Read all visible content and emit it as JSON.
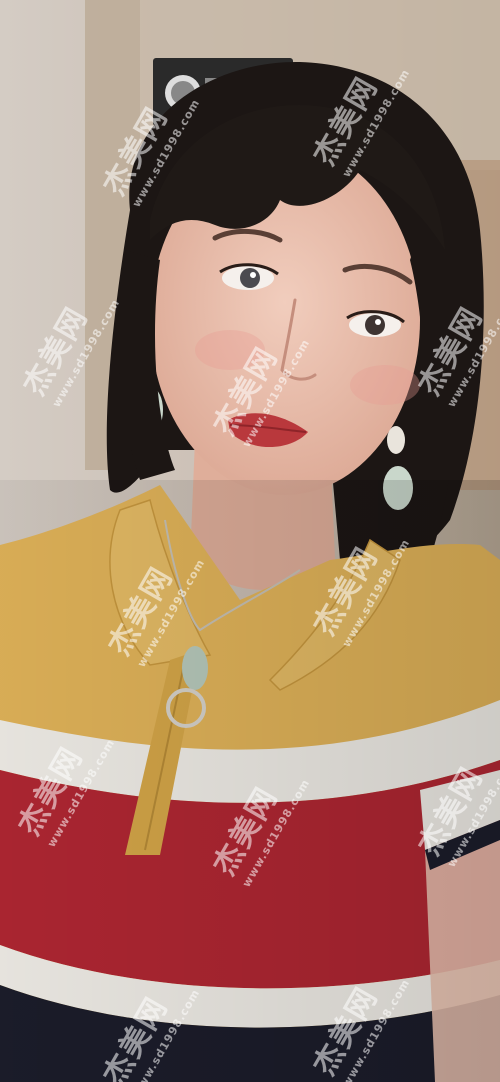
{
  "image": {
    "subject": "selfie-portrait",
    "colors": {
      "background_wall": "#cfc6bd",
      "door_frame": "#b9a995",
      "hair": "#1c1614",
      "skin": "#ecc1b0",
      "lips": "#b9383c",
      "shirt_yellow": "#e3b55a",
      "shirt_red": "#b22733",
      "shirt_white": "#f2efe9",
      "shirt_navy": "#1c1d2b"
    }
  },
  "watermark": {
    "logo_text": "杰美网",
    "url_text": "www.sd1998.com"
  }
}
